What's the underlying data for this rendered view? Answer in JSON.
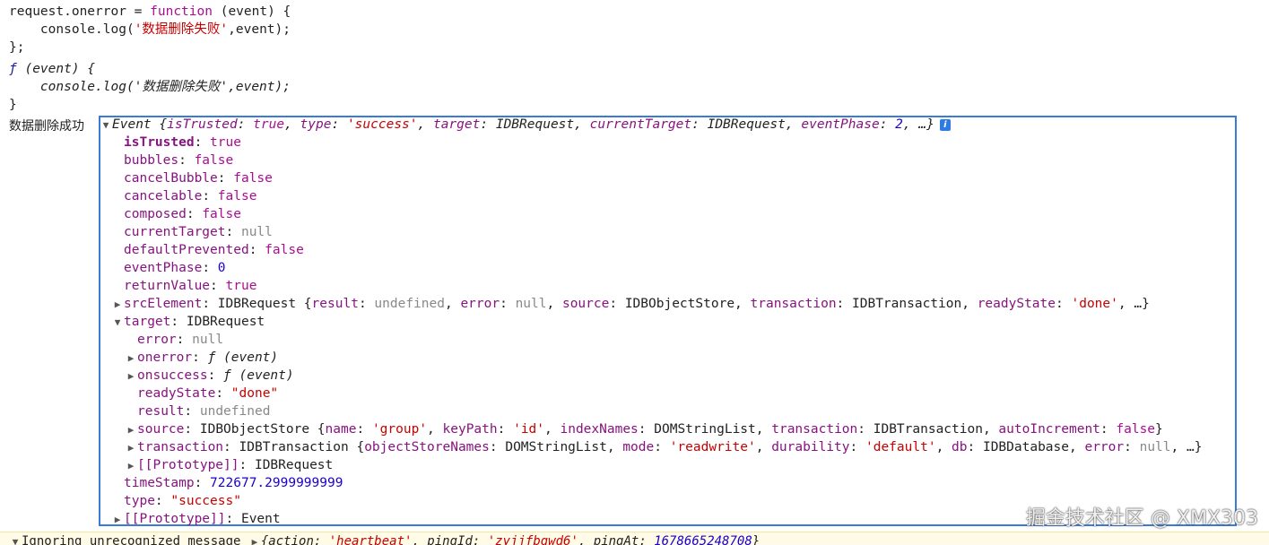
{
  "code": {
    "l1_a": "request.onerror = ",
    "l1_kw": "function",
    "l1_b": " (event) {",
    "l2_a": "    console.log(",
    "l2_str": "'数据删除失败'",
    "l2_b": ",event);",
    "l3": "};",
    "l4_f": "ƒ",
    "l4_b": " (event) {",
    "l5_a": "    console.log('数据删除失败',event);",
    "l6": "}"
  },
  "log_label": "数据删除成功",
  "event": {
    "summary_a": "Event {",
    "summary_k1": "isTrusted",
    "summary_v1": "true",
    "summary_k2": "type",
    "summary_v2": "'success'",
    "summary_k3": "target",
    "summary_v3": "IDBRequest",
    "summary_k4": "currentTarget",
    "summary_v4": "IDBRequest",
    "summary_k5": "eventPhase",
    "summary_v5": "2",
    "summary_end": ", …}",
    "info_icon": "i",
    "props": [
      {
        "k": "isTrusted",
        "v": "true"
      },
      {
        "k": "bubbles",
        "v": "false"
      },
      {
        "k": "cancelBubble",
        "v": "false"
      },
      {
        "k": "cancelable",
        "v": "false"
      },
      {
        "k": "composed",
        "v": "false"
      },
      {
        "k": "currentTarget",
        "v": "null"
      },
      {
        "k": "defaultPrevented",
        "v": "false"
      },
      {
        "k": "eventPhase",
        "v": "0"
      },
      {
        "k": "returnValue",
        "v": "true"
      }
    ],
    "srcElement": {
      "k": "srcElement",
      "v": "IDBRequest {",
      "r_k": "result",
      "r_v": "undefined",
      "e_k": "error",
      "e_v": "null",
      "s_k": "source",
      "s_v": "IDBObjectStore",
      "t_k": "transaction",
      "t_v": "IDBTransaction",
      "rs_k": "readyState",
      "rs_v": "'done'",
      "end": ", …}"
    },
    "target": {
      "k": "target",
      "v": "IDBRequest",
      "error_k": "error",
      "error_v": "null",
      "onerror_k": "onerror",
      "onerror_v": "ƒ (event)",
      "onsuccess_k": "onsuccess",
      "onsuccess_v": "ƒ (event)",
      "readyState_k": "readyState",
      "readyState_v": "\"done\"",
      "result_k": "result",
      "result_v": "undefined",
      "source_k": "source",
      "source_v": "IDBObjectStore {",
      "source_name_k": "name",
      "source_name_v": "'group'",
      "source_kp_k": "keyPath",
      "source_kp_v": "'id'",
      "source_in_k": "indexNames",
      "source_in_v": "DOMStringList",
      "source_tx_k": "transaction",
      "source_tx_v": "IDBTransaction",
      "source_ai_k": "autoIncrement",
      "source_ai_v": "false",
      "transaction_k": "transaction",
      "transaction_v": "IDBTransaction {",
      "tx_osn_k": "objectStoreNames",
      "tx_osn_v": "DOMStringList",
      "tx_mode_k": "mode",
      "tx_mode_v": "'readwrite'",
      "tx_dur_k": "durability",
      "tx_dur_v": "'default'",
      "tx_db_k": "db",
      "tx_db_v": "IDBDatabase",
      "tx_err_k": "error",
      "tx_err_v": "null",
      "tx_end": ", …}",
      "proto_k": "[[Prototype]]",
      "proto_v": "IDBRequest"
    },
    "timeStamp_k": "timeStamp",
    "timeStamp_v": "722677.2999999999",
    "type_k": "type",
    "type_v": "\"success\"",
    "proto_k": "[[Prototype]]",
    "proto_v": "Event"
  },
  "warning": {
    "text_a": "Ignoring unrecognized message",
    "text_b": "{action: ",
    "action_v": "'heartbeat'",
    "ping_k": ", pingId: ",
    "ping_v": "'zyjjfbgwd6'",
    "pingat_k": ", pingAt: ",
    "pingat_v": "1678665248708",
    "end": "}"
  },
  "watermark": "掘金技术社区 @ XMX303"
}
